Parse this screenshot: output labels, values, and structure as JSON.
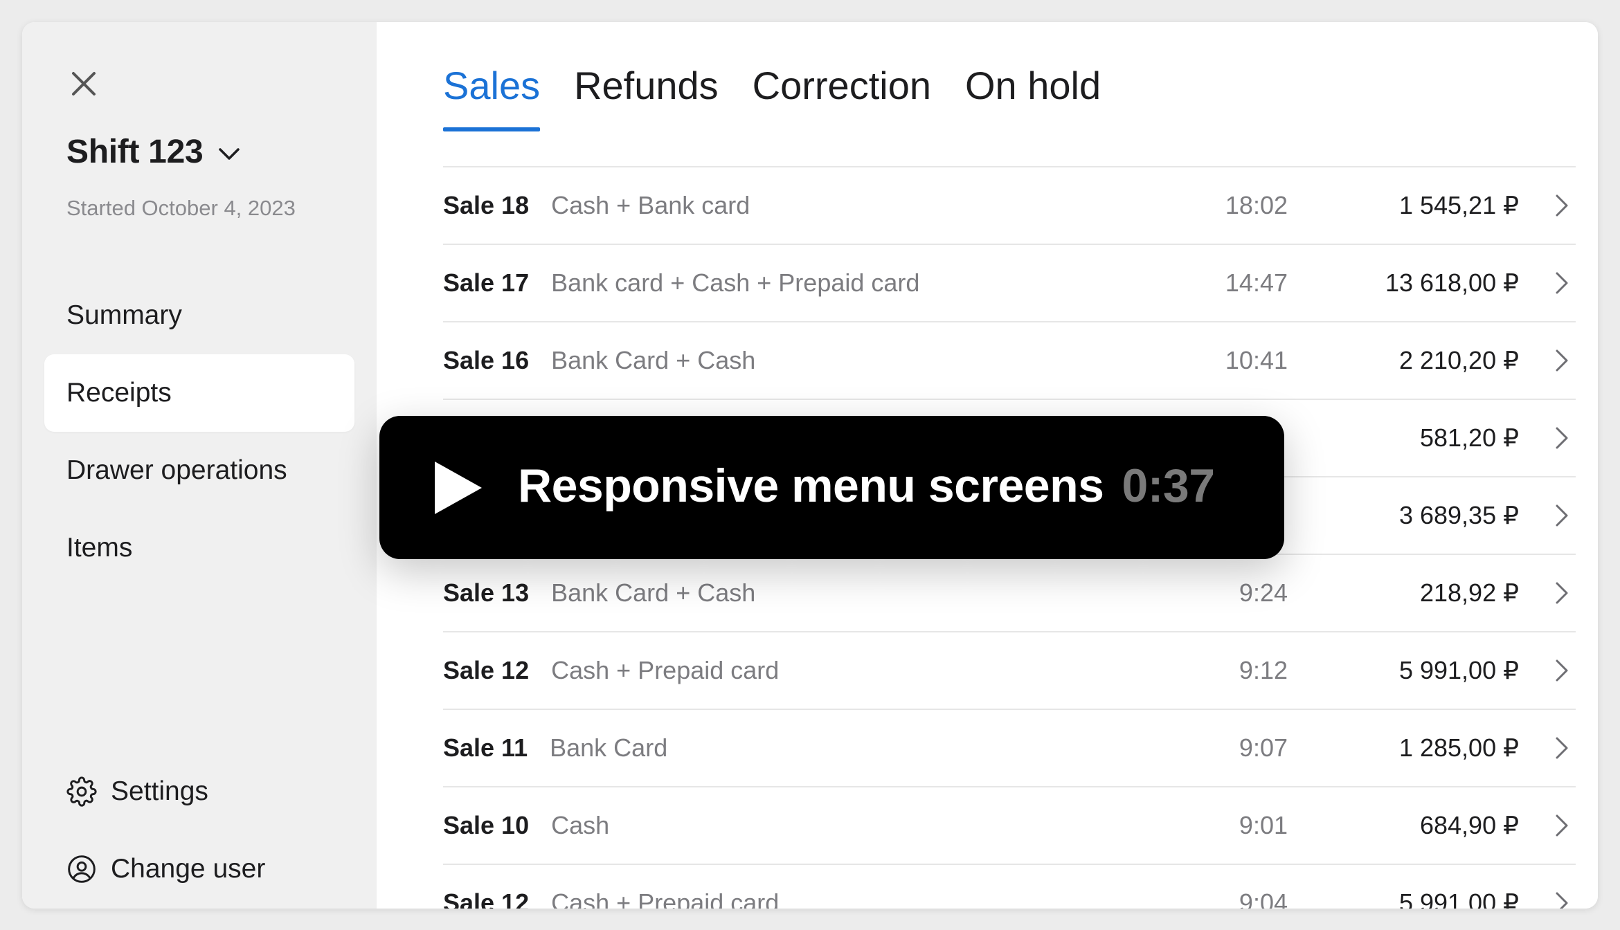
{
  "sidebar": {
    "shift_title": "Shift 123",
    "shift_subtitle": "Started October 4, 2023",
    "nav": [
      {
        "label": "Summary",
        "active": false
      },
      {
        "label": "Receipts",
        "active": true
      },
      {
        "label": "Drawer operations",
        "active": false
      },
      {
        "label": "Items",
        "active": false
      }
    ],
    "settings_label": "Settings",
    "change_user_label": "Change user"
  },
  "tabs": [
    {
      "label": "Sales",
      "active": true
    },
    {
      "label": "Refunds",
      "active": false
    },
    {
      "label": "Correction",
      "active": false
    },
    {
      "label": "On hold",
      "active": false
    }
  ],
  "receipts": [
    {
      "name": "Sale 18",
      "payment": "Cash + Bank card",
      "time": "18:02",
      "amount": "1 545,21 ₽"
    },
    {
      "name": "Sale 17",
      "payment": "Bank card + Cash + Prepaid card",
      "time": "14:47",
      "amount": "13 618,00 ₽"
    },
    {
      "name": "Sale 16",
      "payment": "Bank Card + Cash",
      "time": "10:41",
      "amount": "2 210,20 ₽"
    },
    {
      "name": "",
      "payment": "",
      "time": "",
      "amount": "581,20 ₽"
    },
    {
      "name": "",
      "payment": "",
      "time": "",
      "amount": "3 689,35 ₽"
    },
    {
      "name": "Sale 13",
      "payment": "Bank Card + Cash",
      "time": "9:24",
      "amount": "218,92 ₽"
    },
    {
      "name": "Sale 12",
      "payment": "Cash + Prepaid card",
      "time": "9:12",
      "amount": "5 991,00 ₽"
    },
    {
      "name": "Sale 11",
      "payment": "Bank Card",
      "time": "9:07",
      "amount": "1 285,00 ₽"
    },
    {
      "name": "Sale 10",
      "payment": "Cash",
      "time": "9:01",
      "amount": "684,90 ₽"
    },
    {
      "name": "Sale 12",
      "payment": "Cash + Prepaid card",
      "time": "9:04",
      "amount": "5 991,00 ₽"
    }
  ],
  "video": {
    "title": "Responsive menu screens",
    "duration": "0:37"
  },
  "colors": {
    "accent": "#1b72d6",
    "sidebar_bg": "#f0f0f0",
    "muted_text": "#7c7c80"
  },
  "icons": [
    "close-icon",
    "chevron-down-icon",
    "gear-icon",
    "user-circle-icon",
    "chevron-right-icon",
    "play-icon"
  ]
}
